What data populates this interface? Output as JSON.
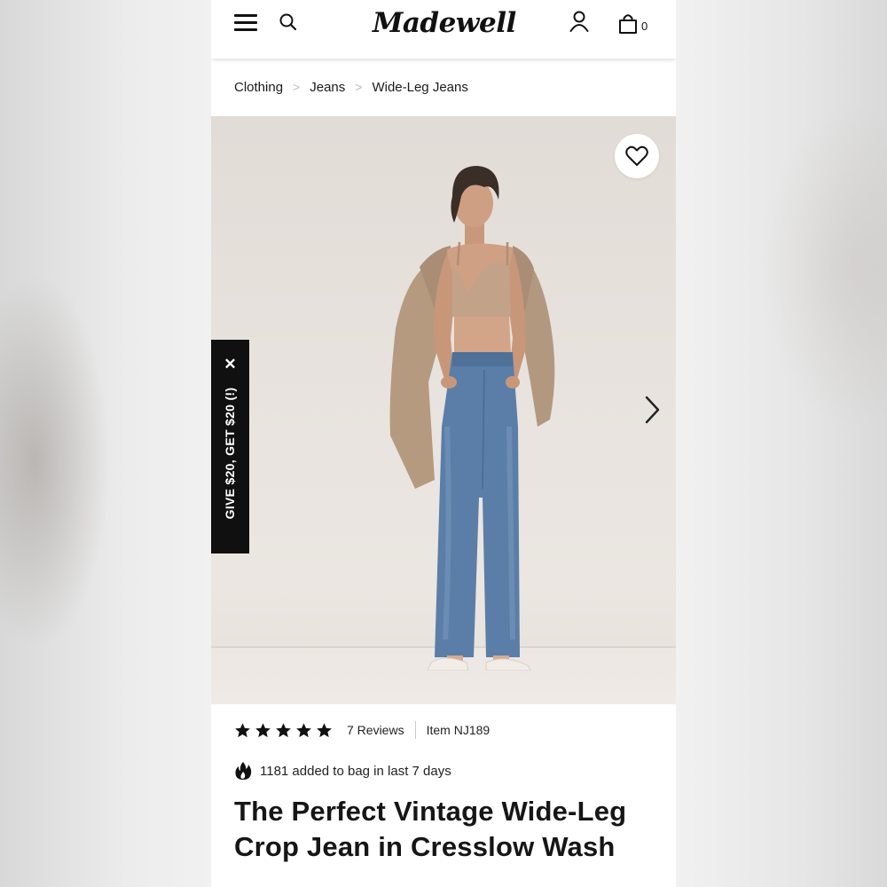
{
  "brand": {
    "logo_text": "Madewell"
  },
  "header": {
    "bag_count": "0"
  },
  "breadcrumb": {
    "items": [
      "Clothing",
      "Jeans",
      "Wide-Leg Jeans"
    ],
    "separator": ">"
  },
  "promo": {
    "label": "GIVE $20, GET $20 (!)",
    "close_glyph": "✕"
  },
  "product": {
    "rating_stars": 5,
    "reviews_label": "7 Reviews",
    "item_label": "Item NJ189",
    "social_proof": "1181 added to bag in last 7 days",
    "title": "The Perfect Vintage Wide-Leg Crop Jean in Cresslow Wash"
  },
  "icons": {
    "menu": "hamburger-menu-icon",
    "search": "search-icon",
    "account": "user-icon",
    "bag": "shopping-bag-icon",
    "wishlist": "heart-icon",
    "next": "chevron-right-icon",
    "trending": "flame-icon",
    "rating": "star-icon"
  },
  "colors": {
    "text": "#161616",
    "promo_bg": "#101010",
    "image_bg": "#e6e0db",
    "denim": "#5b7ea8",
    "top": "#c2a389",
    "jacket": "#b59a80"
  }
}
